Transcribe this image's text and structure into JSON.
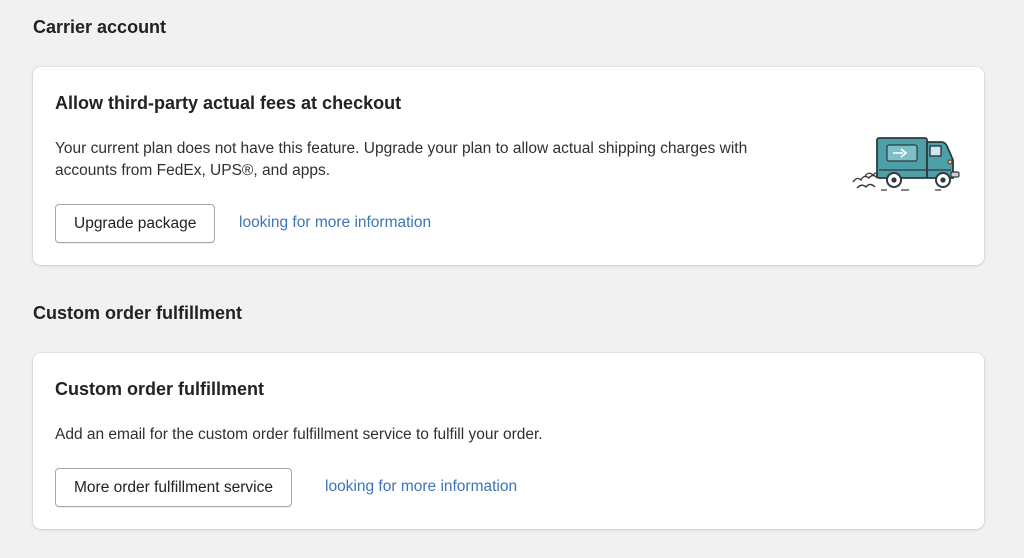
{
  "carrier_section": {
    "title": "Carrier account",
    "card": {
      "title": "Allow third-party actual fees at checkout",
      "description": "Your current plan does not have this feature. Upgrade your plan to allow actual shipping charges with accounts from FedEx, UPS®, and apps.",
      "button_label": "Upgrade package",
      "link_label": "looking for more information",
      "illustration": "delivery-truck-icon"
    }
  },
  "fulfillment_section": {
    "title": "Custom order fulfillment",
    "card": {
      "title": "Custom order fulfillment",
      "description": "Add an email for the custom order fulfillment service to fulfill your order.",
      "button_label": "More order fulfillment service",
      "link_label": "looking for more information"
    }
  },
  "colors": {
    "background": "#f1f1f1",
    "card": "#ffffff",
    "link": "#3f74b5",
    "truck_body": "#4f9fa8"
  }
}
